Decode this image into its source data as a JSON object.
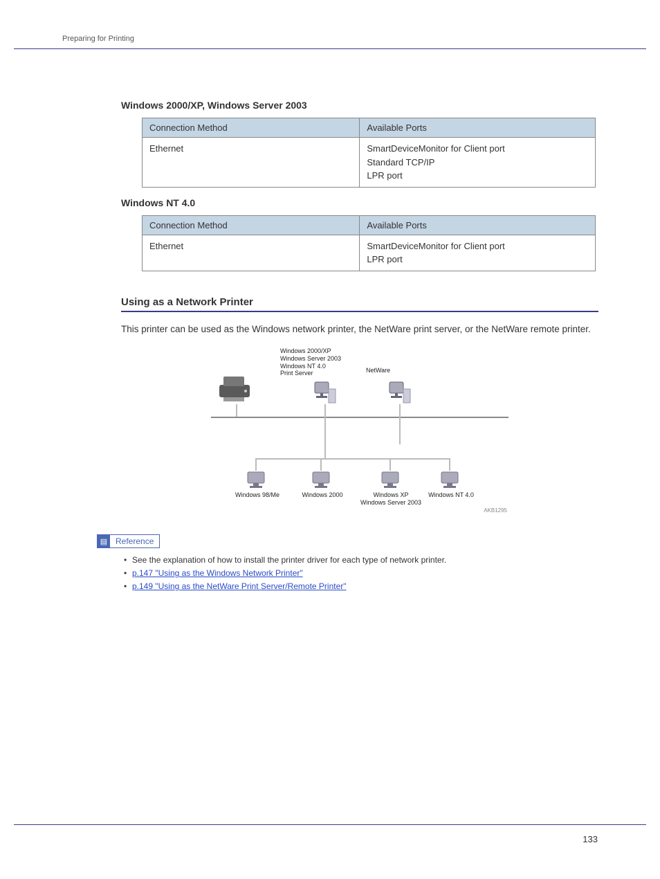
{
  "header": {
    "breadcrumb": "Preparing for Printing"
  },
  "section1": {
    "heading": "Windows 2000/XP, Windows Server 2003",
    "th1": "Connection Method",
    "th2": "Available Ports",
    "row": {
      "method": "Ethernet",
      "ports": "SmartDeviceMonitor for Client port\nStandard TCP/IP\nLPR port"
    }
  },
  "section2": {
    "heading": "Windows NT 4.0",
    "th1": "Connection Method",
    "th2": "Available Ports",
    "row": {
      "method": "Ethernet",
      "ports": "SmartDeviceMonitor for Client port\nLPR port"
    }
  },
  "section3": {
    "heading": "Using as a Network Printer",
    "body": "This printer can be used as the Windows network printer, the NetWare print server, or the NetWare remote printer."
  },
  "diagram": {
    "server_labels": "Windows 2000/XP\nWindows Server 2003\nWindows NT 4.0\nPrint Server",
    "netware": "NetWare",
    "clients": [
      "Windows 98/Me",
      "Windows 2000",
      "Windows XP\nWindows Server 2003",
      "Windows NT 4.0"
    ],
    "code": "AKB1295"
  },
  "reference": {
    "label": "Reference",
    "items": [
      {
        "text": "See the explanation of how to install the printer driver for each type of network printer.",
        "link": false
      },
      {
        "text": "p.147 \"Using as the Windows Network Printer\"",
        "link": true
      },
      {
        "text": "p.149 \"Using as the NetWare Print Server/Remote Printer\"",
        "link": true
      }
    ]
  },
  "page_number": "133"
}
